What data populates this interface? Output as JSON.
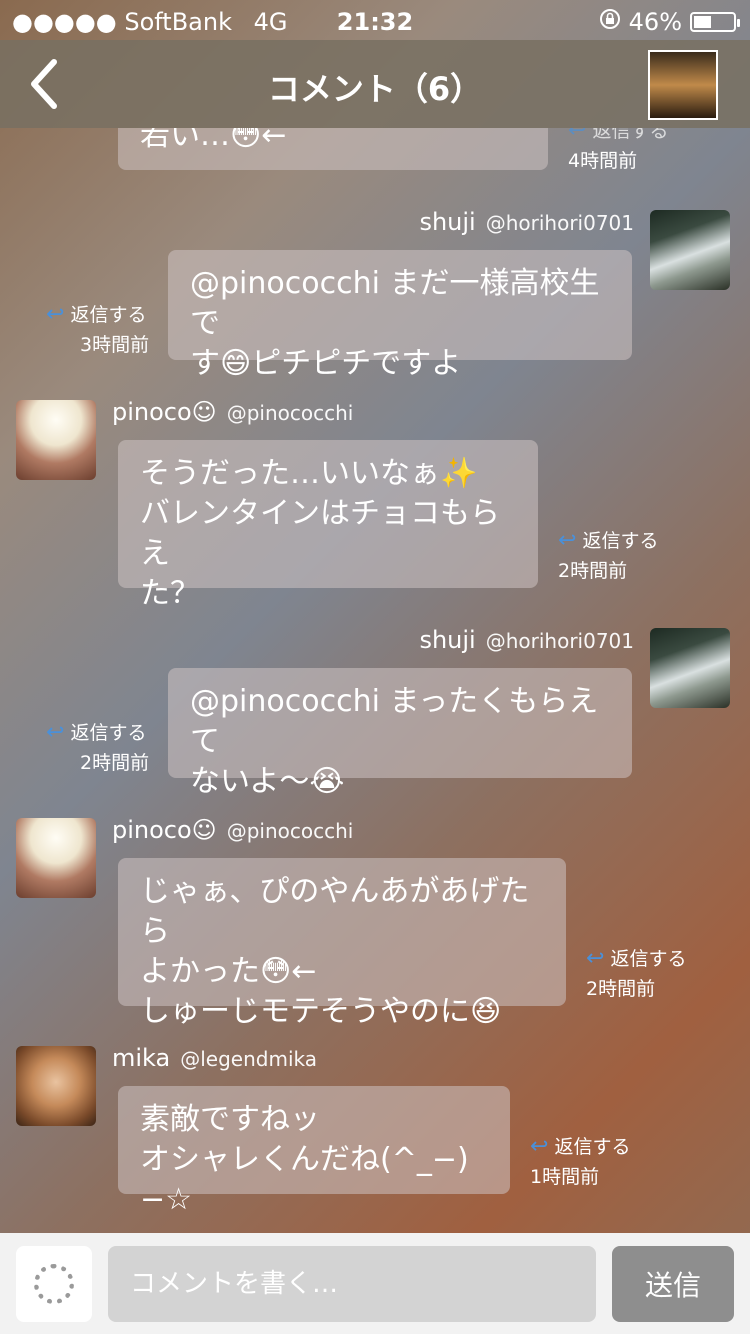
{
  "status_bar": {
    "carrier": "●●●●● SoftBank",
    "network": "4G",
    "time": "21:32",
    "battery": "46%",
    "battery_level": 0.46
  },
  "header": {
    "title": "コメント（6）"
  },
  "comments": [
    {
      "text": "若い…😳←",
      "time": "4時間前",
      "reply": "返信する"
    },
    {
      "name": "shuji",
      "handle": "@horihori0701",
      "text_line1": "@pinococchi まだ一様高校生で",
      "text_line2": "す😄ピチピチですよ",
      "reply": "返信する",
      "time": "3時間前"
    },
    {
      "name": "pinoco☺",
      "handle": "@pinococchi",
      "text_line1": "そうだった…いいなぁ✨",
      "text_line2": "バレンタインはチョコもらえ",
      "text_line3": "た？",
      "reply": "返信する",
      "time": "2時間前"
    },
    {
      "name": "shuji",
      "handle": "@horihori0701",
      "text_line1": "@pinococchi まったくもらえて",
      "text_line2": "ないよ〜😭",
      "reply": "返信する",
      "time": "2時間前"
    },
    {
      "name": "pinoco☺",
      "handle": "@pinococchi",
      "text_line1": "じゃぁ、ぴのやんあがあげたら",
      "text_line2": "よかった😳←",
      "text_line3": "しゅーじモテそうやのに😆",
      "reply": "返信する",
      "time": "2時間前"
    },
    {
      "name": "mika",
      "handle": "@legendmika",
      "text_line1": "素敵ですねッ",
      "text_line2": "オシャレくんだね(^_−)−☆",
      "reply": "返信する",
      "time": "1時間前"
    }
  ],
  "footer": {
    "placeholder": "コメントを書く…",
    "send_label": "送信"
  }
}
